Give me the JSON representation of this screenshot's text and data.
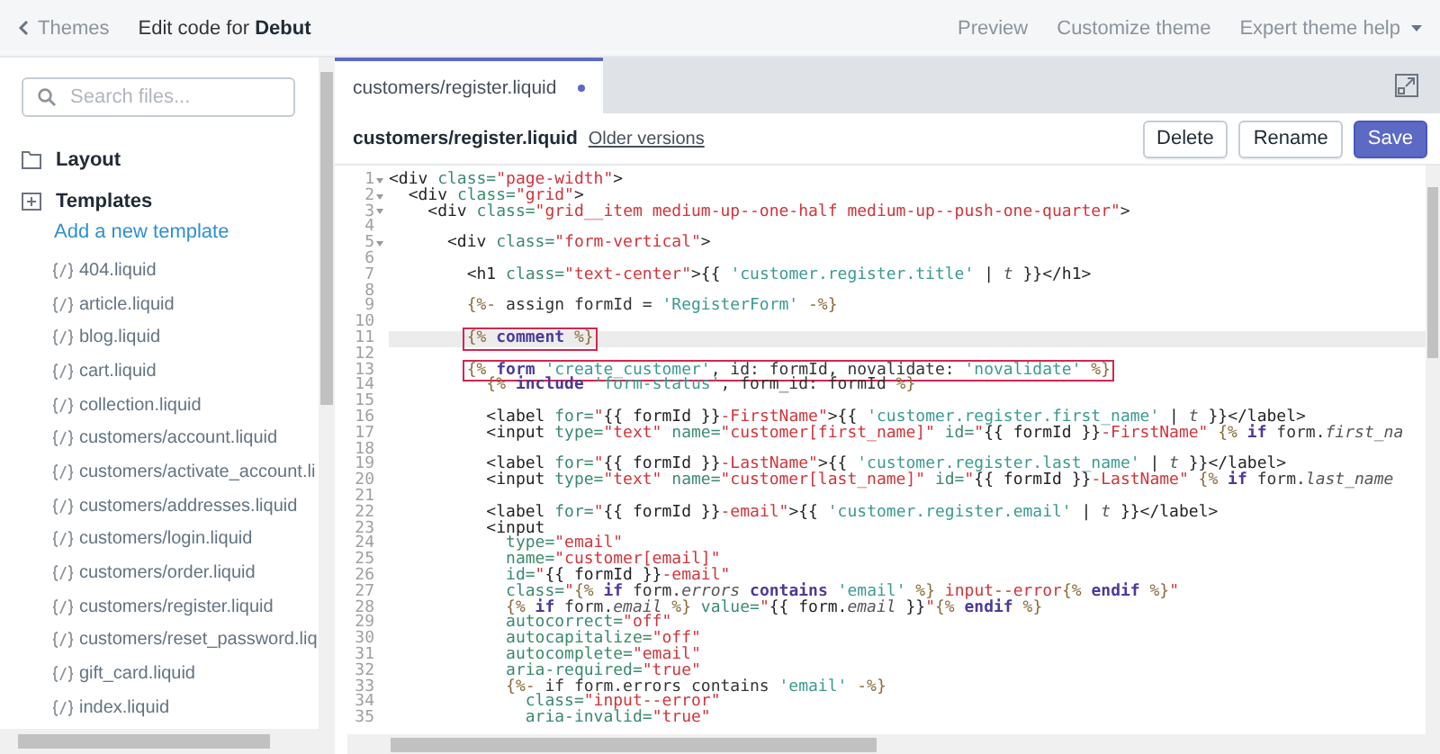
{
  "topbar": {
    "back": "Themes",
    "title": "Edit code for **Debut**",
    "links": [
      "Preview",
      "Customize theme",
      "Expert theme help"
    ]
  },
  "sidebar": {
    "search": {
      "placeholder": "Search files..."
    },
    "folders": [
      {
        "label": "Layout",
        "kind": "folder"
      },
      {
        "label": "Templates",
        "kind": "new",
        "add_link": "Add a new template",
        "files": [
          {
            "name": "404.liquid",
            "selected": false
          },
          {
            "name": "article.liquid",
            "selected": false
          },
          {
            "name": "blog.liquid",
            "selected": false
          },
          {
            "name": "cart.liquid",
            "selected": false
          },
          {
            "name": "collection.liquid",
            "selected": false
          },
          {
            "name": "customers/account.liquid",
            "selected": false
          },
          {
            "name": "customers/activate_account.li",
            "selected": false
          },
          {
            "name": "customers/addresses.liquid",
            "selected": false
          },
          {
            "name": "customers/login.liquid",
            "selected": false
          },
          {
            "name": "customers/order.liquid",
            "selected": false
          },
          {
            "name": "customers/register.liquid",
            "selected": false
          },
          {
            "name": "customers/reset_password.liq",
            "selected": false
          },
          {
            "name": "gift_card.liquid",
            "selected": false
          },
          {
            "name": "index.liquid",
            "selected": false
          }
        ]
      }
    ]
  },
  "tab": {
    "label": "customers/register.liquid",
    "unsaved": true
  },
  "file": {
    "name": "customers/register.liquid",
    "versions_link": "Older versions"
  },
  "buttons": [
    {
      "label": "Delete",
      "kind": "secondary"
    },
    {
      "label": "Rename",
      "kind": "secondary"
    },
    {
      "label": "Save",
      "kind": "primary"
    }
  ],
  "editor": {
    "lines": [
      {
        "n": "1",
        "fold": true,
        "active": false,
        "marked": false,
        "code": [
          {
            "kind": "tag",
            "text": "<div "
          },
          {
            "kind": "attr",
            "text": "class="
          },
          {
            "kind": "str",
            "text": "\"page-width\""
          },
          {
            "kind": "tag",
            "text": ">"
          }
        ]
      },
      {
        "n": "2",
        "fold": true,
        "active": false,
        "marked": false,
        "code": [
          {
            "kind": "tag",
            "text": "  <div "
          },
          {
            "kind": "attr",
            "text": "class="
          },
          {
            "kind": "str",
            "text": "\"grid\""
          },
          {
            "kind": "tag",
            "text": ">"
          }
        ]
      },
      {
        "n": "3",
        "fold": true,
        "active": false,
        "marked": false,
        "code": [
          {
            "kind": "tag",
            "text": "    <div "
          },
          {
            "kind": "attr",
            "text": "class="
          },
          {
            "kind": "str",
            "text": "\"grid__item medium-up--one-half medium-up--push-one-quarter\""
          },
          {
            "kind": "tag",
            "text": ">"
          }
        ]
      },
      {
        "n": "4",
        "fold": false,
        "active": false,
        "marked": false
      },
      {
        "n": "5",
        "fold": true,
        "active": false,
        "marked": false,
        "code": [
          {
            "kind": "tag",
            "text": "      <div "
          },
          {
            "kind": "attr",
            "text": "class="
          },
          {
            "kind": "str",
            "text": "\"form-vertical\""
          },
          {
            "kind": "tag",
            "text": ">"
          }
        ]
      },
      {
        "n": "6",
        "fold": false,
        "active": false,
        "marked": false
      },
      {
        "n": "7",
        "fold": false,
        "active": false,
        "marked": false,
        "code": [
          {
            "kind": "tag",
            "text": "        <h1 "
          },
          {
            "kind": "attr",
            "text": "class="
          },
          {
            "kind": "str",
            "text": "\"text-center\""
          },
          {
            "kind": "tag",
            "text": ">{{ "
          },
          {
            "kind": "lstr",
            "text": "'customer.register.title'"
          },
          {
            "kind": "tag",
            "text": " | "
          },
          {
            "kind": "ital",
            "text": "t"
          },
          {
            "kind": "tag",
            "text": " }}</h1>"
          }
        ]
      },
      {
        "n": "8",
        "fold": false,
        "active": false,
        "marked": false
      },
      {
        "n": "9",
        "fold": false,
        "active": false,
        "marked": false,
        "code": [
          {
            "kind": "delim",
            "text": "        {%-"
          },
          {
            "kind": "var",
            "text": " assign formId = "
          },
          {
            "kind": "lstr",
            "text": "'RegisterForm'"
          },
          {
            "kind": "delim",
            "text": " -%}"
          }
        ]
      },
      {
        "n": "10",
        "fold": false,
        "active": false,
        "marked": false
      },
      {
        "n": "11",
        "fold": false,
        "active": true,
        "marked": true,
        "code": [
          {
            "kind": "delim",
            "text": "        {%"
          },
          {
            "kind": "kw",
            "text": " comment"
          },
          {
            "kind": "delim",
            "text": " %}"
          }
        ]
      },
      {
        "n": "12",
        "fold": false,
        "active": false,
        "marked": false
      },
      {
        "n": "13",
        "fold": false,
        "active": false,
        "marked": true,
        "code": [
          {
            "kind": "delim",
            "text": "        {%"
          },
          {
            "kind": "kw",
            "text": " form"
          },
          {
            "kind": "lstr",
            "text": " 'create_customer'"
          },
          {
            "kind": "var",
            "text": ", id: formId, novalidate: "
          },
          {
            "kind": "lstr",
            "text": "'novalidate'"
          },
          {
            "kind": "delim",
            "text": " %}"
          }
        ]
      },
      {
        "n": "14",
        "fold": false,
        "active": false,
        "marked": false,
        "code": [
          {
            "kind": "delim",
            "text": "          {%"
          },
          {
            "kind": "kw",
            "text": " include"
          },
          {
            "kind": "lstr",
            "text": " 'form-status'"
          },
          {
            "kind": "var",
            "text": ", form_id: formId "
          },
          {
            "kind": "delim",
            "text": "%}"
          }
        ]
      },
      {
        "n": "15",
        "fold": false,
        "active": false,
        "marked": false
      },
      {
        "n": "16",
        "fold": false,
        "active": false,
        "marked": false,
        "code": [
          {
            "kind": "tag",
            "text": "          <label "
          },
          {
            "kind": "attr",
            "text": "for="
          },
          {
            "kind": "str",
            "text": "\""
          },
          {
            "kind": "tag",
            "text": "{{ formId }}"
          },
          {
            "kind": "str",
            "text": "-FirstName\""
          },
          {
            "kind": "tag",
            "text": ">{{ "
          },
          {
            "kind": "lstr",
            "text": "'customer.register.first_name'"
          },
          {
            "kind": "tag",
            "text": " | "
          },
          {
            "kind": "ital",
            "text": "t"
          },
          {
            "kind": "tag",
            "text": " }}</label>"
          }
        ]
      },
      {
        "n": "17",
        "fold": false,
        "active": false,
        "marked": false,
        "code": [
          {
            "kind": "tag",
            "text": "          <input "
          },
          {
            "kind": "attr",
            "text": "type="
          },
          {
            "kind": "str",
            "text": "\"text\""
          },
          {
            "kind": "attr",
            "text": " name="
          },
          {
            "kind": "str",
            "text": "\"customer[first_name]\""
          },
          {
            "kind": "attr",
            "text": " id="
          },
          {
            "kind": "str",
            "text": "\""
          },
          {
            "kind": "tag",
            "text": "{{ formId }}"
          },
          {
            "kind": "str",
            "text": "-FirstName\""
          },
          {
            "kind": "delim",
            "text": " {%"
          },
          {
            "kind": "kw",
            "text": " if"
          },
          {
            "kind": "var",
            "text": " form."
          },
          {
            "kind": "ital",
            "text": "first_na"
          }
        ]
      },
      {
        "n": "18",
        "fold": false,
        "active": false,
        "marked": false
      },
      {
        "n": "19",
        "fold": false,
        "active": false,
        "marked": false,
        "code": [
          {
            "kind": "tag",
            "text": "          <label "
          },
          {
            "kind": "attr",
            "text": "for="
          },
          {
            "kind": "str",
            "text": "\""
          },
          {
            "kind": "tag",
            "text": "{{ formId }}"
          },
          {
            "kind": "str",
            "text": "-LastName\""
          },
          {
            "kind": "tag",
            "text": ">{{ "
          },
          {
            "kind": "lstr",
            "text": "'customer.register.last_name'"
          },
          {
            "kind": "tag",
            "text": " | "
          },
          {
            "kind": "ital",
            "text": "t"
          },
          {
            "kind": "tag",
            "text": " }}</label>"
          }
        ]
      },
      {
        "n": "20",
        "fold": false,
        "active": false,
        "marked": false,
        "code": [
          {
            "kind": "tag",
            "text": "          <input "
          },
          {
            "kind": "attr",
            "text": "type="
          },
          {
            "kind": "str",
            "text": "\"text\""
          },
          {
            "kind": "attr",
            "text": " name="
          },
          {
            "kind": "str",
            "text": "\"customer[last_name]\""
          },
          {
            "kind": "attr",
            "text": " id="
          },
          {
            "kind": "str",
            "text": "\""
          },
          {
            "kind": "tag",
            "text": "{{ formId }}"
          },
          {
            "kind": "str",
            "text": "-LastName\""
          },
          {
            "kind": "delim",
            "text": " {%"
          },
          {
            "kind": "kw",
            "text": " if"
          },
          {
            "kind": "var",
            "text": " form."
          },
          {
            "kind": "ital",
            "text": "last_name"
          }
        ]
      },
      {
        "n": "21",
        "fold": false,
        "active": false,
        "marked": false
      },
      {
        "n": "22",
        "fold": false,
        "active": false,
        "marked": false,
        "code": [
          {
            "kind": "tag",
            "text": "          <label "
          },
          {
            "kind": "attr",
            "text": "for="
          },
          {
            "kind": "str",
            "text": "\""
          },
          {
            "kind": "tag",
            "text": "{{ formId }}"
          },
          {
            "kind": "str",
            "text": "-email\""
          },
          {
            "kind": "tag",
            "text": ">{{ "
          },
          {
            "kind": "lstr",
            "text": "'customer.register.email'"
          },
          {
            "kind": "tag",
            "text": " | "
          },
          {
            "kind": "ital",
            "text": "t"
          },
          {
            "kind": "tag",
            "text": " }}</label>"
          }
        ]
      },
      {
        "n": "23",
        "fold": false,
        "active": false,
        "marked": false,
        "code": [
          {
            "kind": "tag",
            "text": "          <input"
          }
        ]
      },
      {
        "n": "24",
        "fold": false,
        "active": false,
        "marked": false,
        "code": [
          {
            "kind": "attr",
            "text": "            type="
          },
          {
            "kind": "str",
            "text": "\"email\""
          }
        ]
      },
      {
        "n": "25",
        "fold": false,
        "active": false,
        "marked": false,
        "code": [
          {
            "kind": "attr",
            "text": "            name="
          },
          {
            "kind": "str",
            "text": "\"customer[email]\""
          }
        ]
      },
      {
        "n": "26",
        "fold": false,
        "active": false,
        "marked": false,
        "code": [
          {
            "kind": "attr",
            "text": "            id="
          },
          {
            "kind": "str",
            "text": "\""
          },
          {
            "kind": "tag",
            "text": "{{ formId }}"
          },
          {
            "kind": "str",
            "text": "-email\""
          }
        ]
      },
      {
        "n": "27",
        "fold": false,
        "active": false,
        "marked": false,
        "code": [
          {
            "kind": "attr",
            "text": "            class="
          },
          {
            "kind": "str",
            "text": "\""
          },
          {
            "kind": "delim",
            "text": "{%"
          },
          {
            "kind": "kw",
            "text": " if"
          },
          {
            "kind": "var",
            "text": " form."
          },
          {
            "kind": "ital",
            "text": "errors"
          },
          {
            "kind": "kw",
            "text": " contains"
          },
          {
            "kind": "lstr",
            "text": " 'email'"
          },
          {
            "kind": "delim",
            "text": " %}"
          },
          {
            "kind": "str",
            "text": " input--error"
          },
          {
            "kind": "delim",
            "text": "{%"
          },
          {
            "kind": "kw",
            "text": " endif"
          },
          {
            "kind": "delim",
            "text": " %}"
          },
          {
            "kind": "str",
            "text": "\""
          }
        ]
      },
      {
        "n": "28",
        "fold": false,
        "active": false,
        "marked": false,
        "code": [
          {
            "kind": "delim",
            "text": "            {%"
          },
          {
            "kind": "kw",
            "text": " if"
          },
          {
            "kind": "var",
            "text": " form."
          },
          {
            "kind": "ital",
            "text": "email"
          },
          {
            "kind": "delim",
            "text": " %}"
          },
          {
            "kind": "attr",
            "text": " value="
          },
          {
            "kind": "str",
            "text": "\""
          },
          {
            "kind": "tag",
            "text": "{{ form."
          },
          {
            "kind": "ital",
            "text": "email"
          },
          {
            "kind": "tag",
            "text": " }}"
          },
          {
            "kind": "str",
            "text": "\""
          },
          {
            "kind": "delim",
            "text": "{%"
          },
          {
            "kind": "kw",
            "text": " endif"
          },
          {
            "kind": "delim",
            "text": " %}"
          }
        ]
      },
      {
        "n": "29",
        "fold": false,
        "active": false,
        "marked": false,
        "code": [
          {
            "kind": "attr",
            "text": "            autocorrect="
          },
          {
            "kind": "str",
            "text": "\"off\""
          }
        ]
      },
      {
        "n": "30",
        "fold": false,
        "active": false,
        "marked": false,
        "code": [
          {
            "kind": "attr",
            "text": "            autocapitalize="
          },
          {
            "kind": "str",
            "text": "\"off\""
          }
        ]
      },
      {
        "n": "31",
        "fold": false,
        "active": false,
        "marked": false,
        "code": [
          {
            "kind": "attr",
            "text": "            autocomplete="
          },
          {
            "kind": "str",
            "text": "\"email\""
          }
        ]
      },
      {
        "n": "32",
        "fold": false,
        "active": false,
        "marked": false,
        "code": [
          {
            "kind": "attr",
            "text": "            aria-required="
          },
          {
            "kind": "str",
            "text": "\"true\""
          }
        ]
      },
      {
        "n": "33",
        "fold": false,
        "active": false,
        "marked": false,
        "code": [
          {
            "kind": "delim",
            "text": "            {%-"
          },
          {
            "kind": "var",
            "text": " if form.errors contains "
          },
          {
            "kind": "lstr",
            "text": "'email'"
          },
          {
            "kind": "delim",
            "text": " -%}"
          }
        ]
      },
      {
        "n": "34",
        "fold": false,
        "active": false,
        "marked": false,
        "code": [
          {
            "kind": "attr",
            "text": "              class="
          },
          {
            "kind": "str",
            "text": "\"input--error\""
          }
        ]
      },
      {
        "n": "35",
        "fold": false,
        "active": false,
        "marked": false,
        "code": [
          {
            "kind": "attr",
            "text": "              aria-invalid="
          },
          {
            "kind": "str",
            "text": "\"true\""
          }
        ]
      }
    ]
  }
}
